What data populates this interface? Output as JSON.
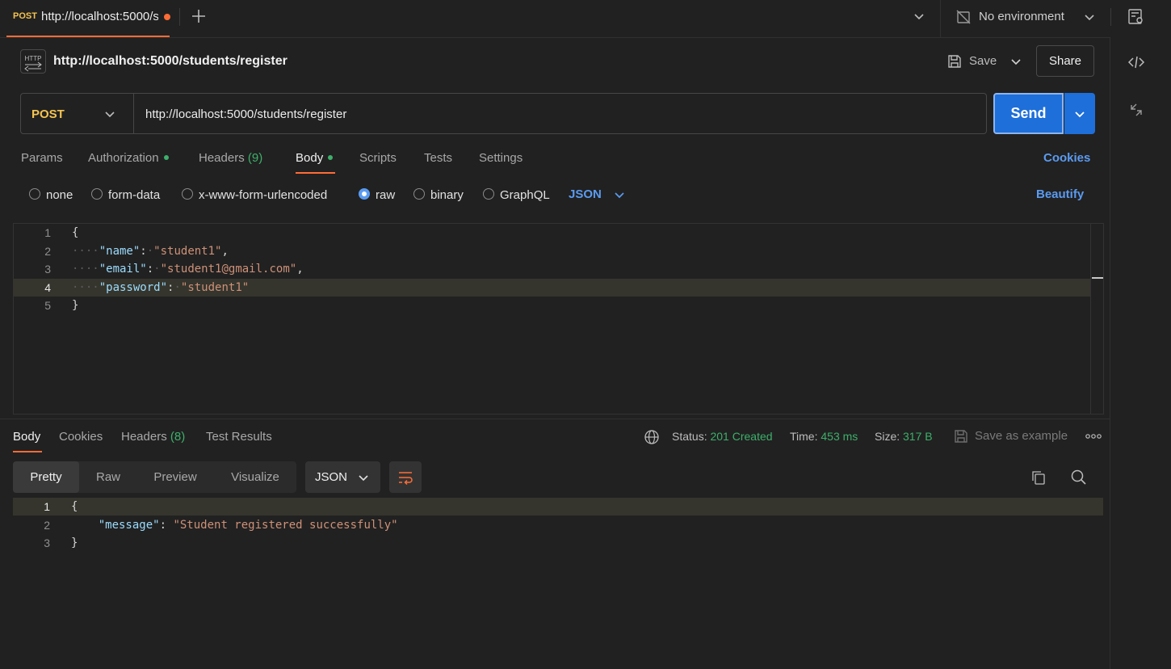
{
  "top_tab": {
    "method": "POST",
    "url": "http://localhost:5000/s"
  },
  "environment": {
    "label": "No environment"
  },
  "request": {
    "title": "http://localhost:5000/students/register",
    "save_label": "Save",
    "share_label": "Share",
    "method": "POST",
    "url": "http://localhost:5000/students/register",
    "send_label": "Send"
  },
  "request_tabs": {
    "params": "Params",
    "authorization": "Authorization",
    "headers": "Headers",
    "headers_count": "(9)",
    "body": "Body",
    "scripts": "Scripts",
    "tests": "Tests",
    "settings": "Settings",
    "cookies": "Cookies"
  },
  "body_types": {
    "none": "none",
    "form_data": "form-data",
    "urlencoded": "x-www-form-urlencoded",
    "raw": "raw",
    "binary": "binary",
    "graphql": "GraphQL",
    "selected": "raw",
    "format": "JSON",
    "beautify": "Beautify"
  },
  "request_body": {
    "line_numbers": [
      "1",
      "2",
      "3",
      "4",
      "5"
    ],
    "open_brace": "{",
    "close_brace": "}",
    "fields": [
      {
        "key": "\"name\"",
        "value": "\"student1\"",
        "comma": ","
      },
      {
        "key": "\"email\"",
        "value": "\"student1@gmail.com\"",
        "comma": ","
      },
      {
        "key": "\"password\"",
        "value": "\"student1\"",
        "comma": ""
      }
    ]
  },
  "response_tabs": {
    "body": "Body",
    "cookies": "Cookies",
    "headers": "Headers",
    "headers_count": "(8)",
    "test_results": "Test Results"
  },
  "response_meta": {
    "status_label": "Status:",
    "status_value": "201 Created",
    "time_label": "Time:",
    "time_value": "453 ms",
    "size_label": "Size:",
    "size_value": "317 B",
    "save_example": "Save as example"
  },
  "view_modes": {
    "pretty": "Pretty",
    "raw": "Raw",
    "preview": "Preview",
    "visualize": "Visualize",
    "format": "JSON"
  },
  "response_body": {
    "line_numbers": [
      "1",
      "2",
      "3"
    ],
    "open_brace": "{",
    "close_brace": "}",
    "key": "\"message\"",
    "value": "\"Student registered successfully\""
  },
  "colors": {
    "accent_orange": "#ff6c37",
    "send_blue": "#1e6fd9",
    "link_blue": "#5b9bf0",
    "method_yellow": "#f5c451",
    "success_green": "#3db06b"
  }
}
